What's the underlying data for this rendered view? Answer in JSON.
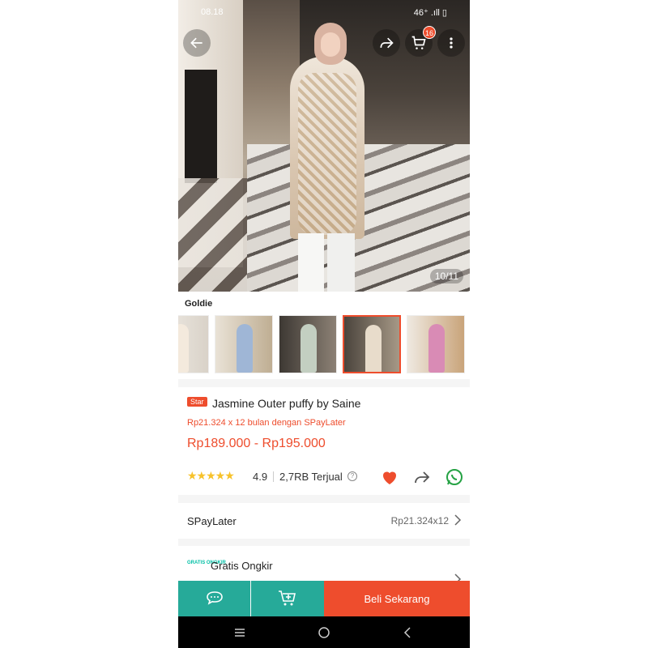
{
  "status_bar": {
    "time": "08.18",
    "indicators": "46⁺ .ıll ▯"
  },
  "hero": {
    "image_counter": "10/11",
    "cart_count": "16",
    "icons": [
      "back-arrow-icon",
      "share-icon",
      "cart-icon",
      "more-vert-icon"
    ]
  },
  "variant": {
    "label": "Goldie",
    "thumbnails": [
      "variant-1",
      "variant-2",
      "variant-3",
      "variant-4",
      "variant-5"
    ],
    "selected_index": 3
  },
  "product": {
    "tag": "Star",
    "title": "Jasmine Outer puffy by Saine",
    "installment": "Rp21.324 x 12 bulan dengan SPayLater",
    "price": "Rp189.000 - Rp195.000",
    "stars": "★★★★★",
    "rating": "4.9",
    "sold": "2,7RB Terjual"
  },
  "rows": {
    "spaylater_label": "SPayLater",
    "spaylater_value": "Rp21.324x12",
    "ongkir_label": "Gratis Ongkir",
    "ongkir_logo": "GRATIS ONGKIR"
  },
  "bottom_bar": {
    "buy_label": "Beli Sekarang"
  },
  "colors": {
    "accent": "#ee4d2d",
    "teal": "#26aa99",
    "star": "#f7c22a"
  }
}
